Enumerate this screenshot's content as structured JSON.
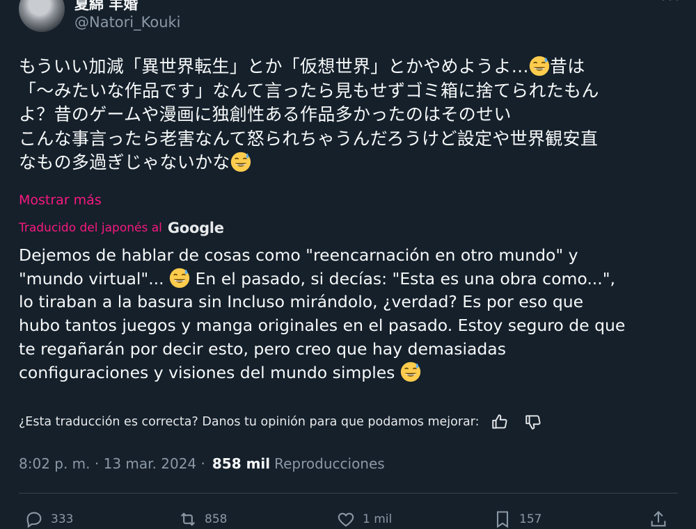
{
  "author": {
    "display_name": "夏綿 羊婚",
    "handle": "@Natori_Kouki"
  },
  "tweet": {
    "lines": [
      "もういい加減「異世界転生」とか「仮想世界」とかやめようよ…",
      "昔は",
      "「〜みたいな作品です」なんて言ったら見もせずゴミ箱に捨てられたもん",
      "よ？昔のゲームや漫画に独創性ある作品多かったのはそのせい",
      "こんな事言ったら老害なんて怒られちゃうんだろうけど設定や世界観安直",
      "なもの多過ぎじゃないかな"
    ],
    "show_more": "Mostrar más"
  },
  "translation": {
    "label": "Traducido del japonés al",
    "provider": "Google",
    "lines": [
      "Dejemos de hablar de cosas como \"reencarnación en otro mundo\" y",
      "\"mundo virtual\"...",
      " En el pasado, si decías: \"Esta es una obra como...\",",
      "lo tiraban a la basura sin Incluso mirándolo, ¿verdad? Es por eso que",
      "hubo tantos juegos y manga originales en el pasado. Estoy seguro de que",
      "te regañarán por decir esto, pero creo que hay demasiadas",
      "configuraciones y visiones del mundo simples"
    ],
    "feedback": "¿Esta traducción es correcta? Danos tu opinión para que podamos mejorar:"
  },
  "meta": {
    "time_date": "8:02 p. m. · 13 mar. 2024 ·",
    "views_count": "858 mil",
    "views_label": "Reproducciones"
  },
  "actions": {
    "replies": "333",
    "reposts": "858",
    "likes": "1 mil",
    "bookmarks": "157"
  },
  "icons": [
    "more-icon",
    "sweat-smile-emoji",
    "thumbs-up-icon",
    "thumbs-down-icon",
    "reply-icon",
    "repost-icon",
    "like-icon",
    "bookmark-icon",
    "share-icon"
  ],
  "colors": {
    "background": "#15202b",
    "accent_pink": "#f91880",
    "secondary_text": "#8b98a5",
    "emoji_yellow": "#ffcc4d"
  }
}
